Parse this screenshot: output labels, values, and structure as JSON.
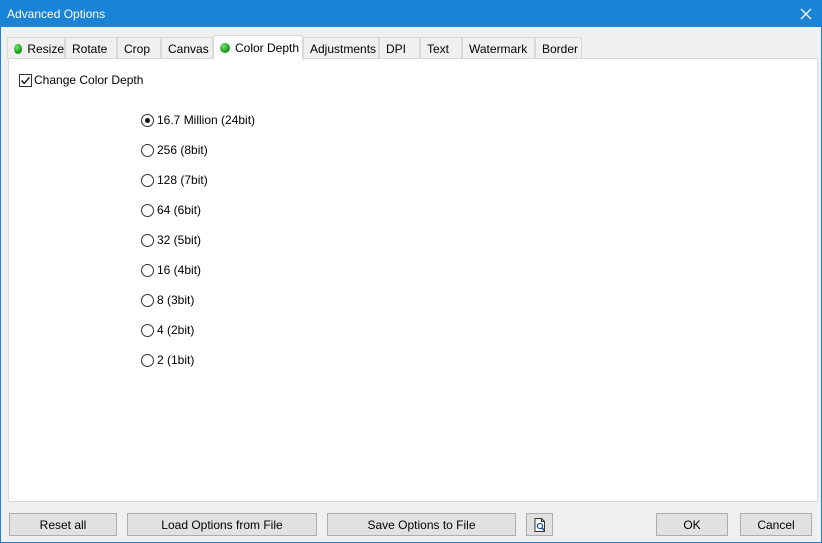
{
  "window": {
    "title": "Advanced Options",
    "close_icon": "close-icon"
  },
  "tabs": [
    {
      "label": "Resize",
      "indicator": true
    },
    {
      "label": "Rotate",
      "indicator": false
    },
    {
      "label": "Crop",
      "indicator": false
    },
    {
      "label": "Canvas",
      "indicator": false
    },
    {
      "label": "Color Depth",
      "indicator": true,
      "active": true
    },
    {
      "label": "Adjustments",
      "indicator": false
    },
    {
      "label": "DPI",
      "indicator": false
    },
    {
      "label": "Text",
      "indicator": false
    },
    {
      "label": "Watermark",
      "indicator": false
    },
    {
      "label": "Border",
      "indicator": false
    }
  ],
  "color_depth": {
    "change_label": "Change Color Depth",
    "change_checked": true,
    "options": [
      {
        "label": "16.7 Million (24bit)",
        "selected": true
      },
      {
        "label": "256 (8bit)",
        "selected": false
      },
      {
        "label": "128 (7bit)",
        "selected": false
      },
      {
        "label": "64 (6bit)",
        "selected": false
      },
      {
        "label": "32 (5bit)",
        "selected": false
      },
      {
        "label": "16 (4bit)",
        "selected": false
      },
      {
        "label": "8 (3bit)",
        "selected": false
      },
      {
        "label": "4 (2bit)",
        "selected": false
      },
      {
        "label": "2 (1bit)",
        "selected": false
      }
    ]
  },
  "buttons": {
    "reset_all": "Reset all",
    "load": "Load Options from File",
    "save": "Save Options to File",
    "preview_icon": "preview-file-icon",
    "ok": "OK",
    "cancel": "Cancel"
  },
  "colors": {
    "titlebar": "#1883d7",
    "indicator_green": "#1ea51e"
  }
}
